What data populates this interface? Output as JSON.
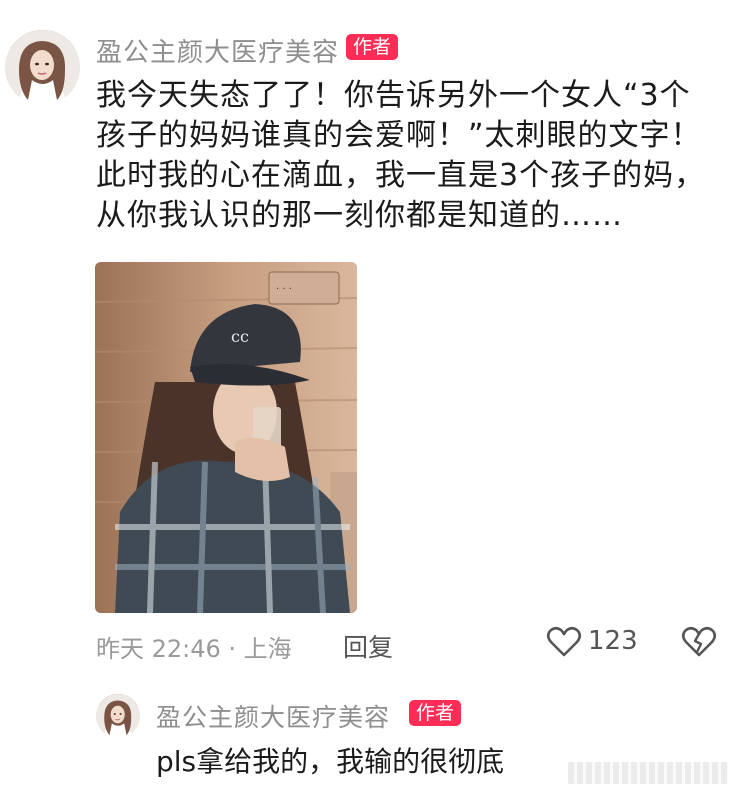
{
  "comment": {
    "username": "盈公主颜大医疗美容",
    "author_badge": "作者",
    "text_lines": [
      "我今天失态了了！你告诉另外一个女人“3个",
      "孩子的妈妈谁真的会爱啊！”太刺眼的文字！",
      "此时我的心在滴血，我一直是3个孩子的妈，",
      "从你我认识的那一刻你都是知道的……"
    ],
    "timestamp": "昨天 22:46 · 上海",
    "reply_label": "回复",
    "like_count": "123",
    "icons": {
      "like": "heart-outline-icon",
      "dislike": "broken-heart-icon"
    }
  },
  "reply": {
    "username": "盈公主颜大医疗美容",
    "author_badge": "作者",
    "text": "pls拿给我的，我输的很彻底"
  }
}
